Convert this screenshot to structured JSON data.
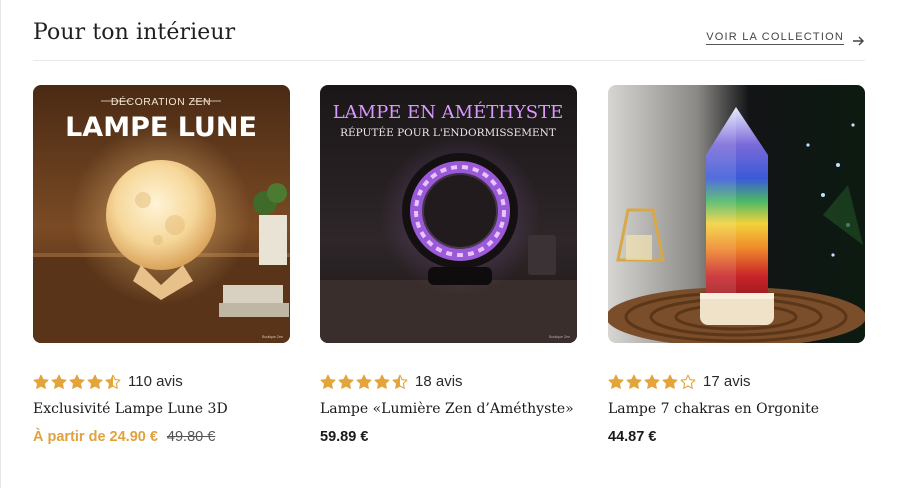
{
  "section": {
    "title": "Pour ton intérieur",
    "view_all_label": "VOIR LA COLLECTION"
  },
  "colors": {
    "accent": "#e0a240",
    "star": "#e3a43c",
    "text": "#1a1a1a"
  },
  "products": [
    {
      "image": {
        "kicker": "DÉCORATION ZEN",
        "headline": "LAMPE LUNE",
        "watermark": "Boutique Zen"
      },
      "rating": 4.5,
      "reviews_label": "110 avis",
      "name": "Exclusivité Lampe Lune 3D",
      "price": "À partir de 24.90 €",
      "compare_price": "49.80 €"
    },
    {
      "image": {
        "headline": "LAMPE EN AMÉTHYSTE",
        "subline": "RÉPUTÉE POUR L'ENDORMISSEMENT",
        "watermark": "Boutique Zen"
      },
      "rating": 4.5,
      "reviews_label": "18 avis",
      "name": "Lampe «Lumière Zen d’Améthyste»",
      "price": "59.89 €"
    },
    {
      "rating": 4,
      "reviews_label": "17 avis",
      "name": "Lampe 7 chakras en Orgonite",
      "price": "44.87 €"
    }
  ]
}
